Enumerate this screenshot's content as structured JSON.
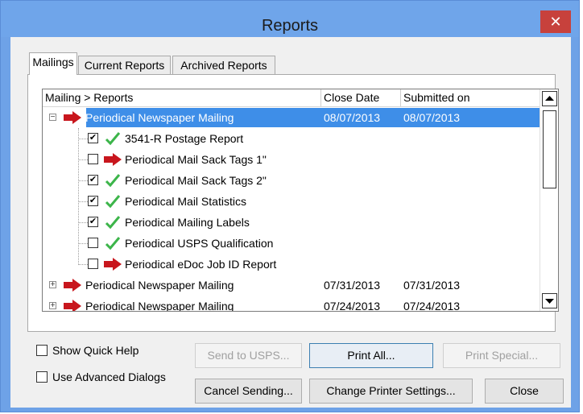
{
  "window": {
    "title": "Reports",
    "close_glyph": "✕"
  },
  "tabs": [
    {
      "label": "Mailings",
      "active": true
    },
    {
      "label": "Current Reports",
      "active": false
    },
    {
      "label": "Archived Reports",
      "active": false
    }
  ],
  "list": {
    "columns": [
      "Mailing > Reports",
      "Close Date",
      "Submitted on"
    ],
    "rows": [
      {
        "type": "mailing",
        "expanded": true,
        "label": "Periodical Newspaper Mailing",
        "close_date": "08/07/2013",
        "submitted_on": "08/07/2013",
        "selected": true,
        "icon": "red-arrow-icon"
      },
      {
        "type": "report",
        "checked": true,
        "label": "3541-R Postage Report",
        "icon": "green-check-icon"
      },
      {
        "type": "report",
        "checked": false,
        "label": "Periodical Mail Sack Tags 1\"",
        "icon": "red-arrow-icon"
      },
      {
        "type": "report",
        "checked": true,
        "label": "Periodical Mail Sack Tags 2\"",
        "icon": "green-check-icon"
      },
      {
        "type": "report",
        "checked": true,
        "label": "Periodical Mail Statistics",
        "icon": "green-check-icon"
      },
      {
        "type": "report",
        "checked": true,
        "label": "Periodical Mailing Labels",
        "icon": "green-check-icon"
      },
      {
        "type": "report",
        "checked": false,
        "label": "Periodical USPS Qualification",
        "icon": "green-check-icon"
      },
      {
        "type": "report",
        "checked": false,
        "label": "Periodical eDoc Job ID Report",
        "icon": "red-arrow-icon"
      },
      {
        "type": "mailing",
        "expanded": false,
        "label": "Periodical Newspaper Mailing",
        "close_date": "07/31/2013",
        "submitted_on": "07/31/2013",
        "selected": false,
        "icon": "red-arrow-icon"
      },
      {
        "type": "mailing",
        "expanded": false,
        "label": "Periodical Newspaper Mailing",
        "close_date": "07/24/2013",
        "submitted_on": "07/24/2013",
        "selected": false,
        "icon": "red-arrow-icon"
      }
    ]
  },
  "options": {
    "show_quick_help": "Show Quick Help",
    "use_advanced_dialogs": "Use Advanced Dialogs"
  },
  "buttons": {
    "send_to_usps": "Send to USPS...",
    "print_all": "Print All...",
    "print_special": "Print Special...",
    "cancel_sending": "Cancel Sending...",
    "change_printer_settings": "Change Printer Settings...",
    "close": "Close"
  },
  "colors": {
    "title_bar": "#6fa5ea",
    "close_button": "#c7413c",
    "selection": "#3e8ee8",
    "red_arrow": "#c8161d",
    "green_check": "#3cb54a"
  }
}
